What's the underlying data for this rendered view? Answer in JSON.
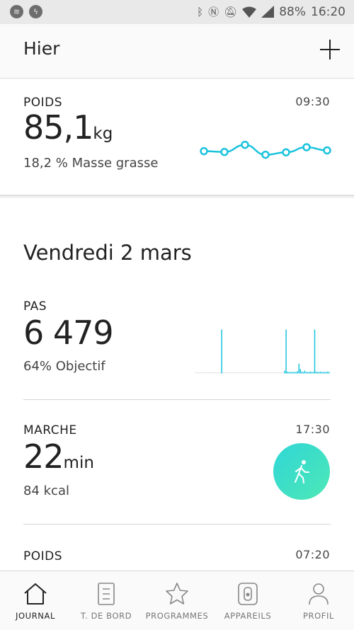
{
  "status_bar": {
    "battery": "88%",
    "time": "16:20"
  },
  "header": {
    "title": "Hier"
  },
  "weight_card": {
    "label": "POIDS",
    "time": "09:30",
    "value": "85,1",
    "unit": "kg",
    "sub": "18,2 % Masse grasse",
    "trend": [
      0.48,
      0.44,
      0.8,
      0.3,
      0.42,
      0.68,
      0.52
    ],
    "accent": "#19c3dd"
  },
  "day_section": {
    "title": "Vendredi 2 mars",
    "steps": {
      "label": "PAS",
      "value": "6 479",
      "sub": "64% Objectif",
      "bars": [
        0,
        0,
        0,
        0,
        0,
        0,
        0,
        0,
        0,
        0,
        0,
        0,
        0,
        0,
        0,
        0,
        0,
        0,
        1,
        0,
        0,
        0,
        0,
        0,
        0,
        0,
        0,
        0,
        0,
        0,
        0,
        0,
        0,
        0,
        0,
        0,
        0,
        0,
        0,
        0,
        0,
        0,
        0,
        0,
        0,
        0,
        0,
        0,
        0,
        0,
        0,
        0,
        0,
        0,
        0,
        0,
        0,
        0,
        0,
        0,
        0,
        0,
        0.06,
        1,
        0.04,
        0.02,
        0.03,
        0.02,
        0.03,
        0.02,
        0.02,
        0.05,
        0.22,
        0.1,
        0.04,
        0.03,
        0.06,
        0.02,
        0.03,
        0.02,
        0.04,
        0.02,
        0.03,
        1,
        0.04,
        0.03,
        0.02,
        0.04,
        0.02,
        0.02,
        0.03,
        0.02,
        0.04,
        0.02
      ]
    },
    "walk": {
      "label": "MARCHE",
      "time": "17:30",
      "value": "22",
      "unit": "min",
      "sub": "84 kcal"
    },
    "weight2": {
      "label": "POIDS",
      "time": "07:20"
    }
  },
  "nav": [
    {
      "label": "JOURNAL",
      "icon": "home-icon"
    },
    {
      "label": "T. DE BORD",
      "icon": "dashboard-icon"
    },
    {
      "label": "PROGRAMMES",
      "icon": "star-icon"
    },
    {
      "label": "APPAREILS",
      "icon": "watch-icon"
    },
    {
      "label": "PROFIL",
      "icon": "profile-icon"
    }
  ]
}
